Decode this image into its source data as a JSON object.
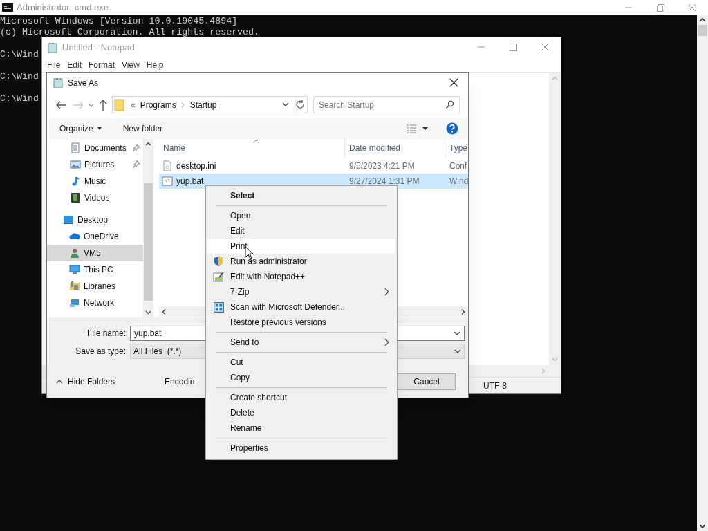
{
  "console": {
    "title": "Administrator: cmd.exe",
    "lines": [
      "Microsoft Windows [Version 10.0.19045.4894]",
      "(c) Microsoft Corporation. All rights reserved."
    ],
    "prompts": [
      "C:\\Wind",
      "C:\\Wind",
      "C:\\Wind"
    ]
  },
  "notepad": {
    "title": "Untitled - Notepad",
    "active": false,
    "menu": [
      "File",
      "Edit",
      "Format",
      "View",
      "Help"
    ],
    "encoding": "UTF-8"
  },
  "save_as": {
    "title": "Save As",
    "path_overflow": "«",
    "path": [
      "Programs",
      "Startup"
    ],
    "search": {
      "placeholder": "Search Startup"
    },
    "toolbar": {
      "organize": "Organize",
      "new_folder": "New folder"
    },
    "quick_access": [
      {
        "kind": "documents",
        "label": "Documents",
        "pinned": true,
        "selected": false
      },
      {
        "kind": "pictures",
        "label": "Pictures",
        "pinned": true,
        "selected": false
      },
      {
        "kind": "music",
        "label": "Music",
        "pinned": false,
        "selected": false
      },
      {
        "kind": "videos",
        "label": "Videos",
        "pinned": false,
        "selected": false
      }
    ],
    "tree": [
      {
        "kind": "desktop",
        "label": "Desktop",
        "selected": false,
        "children": [
          {
            "kind": "cloud",
            "label": "OneDrive",
            "selected": false
          },
          {
            "kind": "user",
            "label": "VM5",
            "selected": true
          },
          {
            "kind": "computer",
            "label": "This PC",
            "selected": false
          },
          {
            "kind": "libraries",
            "label": "Libraries",
            "selected": false
          },
          {
            "kind": "network",
            "label": "Network",
            "selected": false
          }
        ]
      }
    ],
    "columns": [
      "Name",
      "Date modified",
      "Type"
    ],
    "files": [
      {
        "kind": "settings",
        "name": "desktop.ini",
        "date": "9/5/2023 4:21 PM",
        "type": "Conf",
        "selected": false
      },
      {
        "kind": "batch",
        "name": "yup.bat",
        "date": "9/27/2024 1:31 PM",
        "type": "Wind",
        "selected": true
      }
    ],
    "file_name": {
      "label": "File name:",
      "value": "yup.bat"
    },
    "save_type": {
      "label": "Save as type:",
      "value": "All Files  (*.*)"
    },
    "hide_folders": "Hide Folders",
    "encoding_label": "Encodin",
    "cancel": "Cancel"
  },
  "context_menu": [
    {
      "kind": "default",
      "label": "Select",
      "highlighted": false
    },
    {
      "kind": "separator"
    },
    {
      "kind": "command",
      "label": "Open",
      "highlighted": false
    },
    {
      "kind": "command",
      "label": "Edit",
      "highlighted": false
    },
    {
      "kind": "command",
      "label": "Print",
      "highlighted": true
    },
    {
      "kind": "shield",
      "label": "Run as administrator",
      "highlighted": false
    },
    {
      "kind": "notepad",
      "label": "Edit with Notepad++",
      "highlighted": false
    },
    {
      "kind": "submenu",
      "label": "7-Zip",
      "highlighted": false
    },
    {
      "kind": "defender",
      "label": "Scan with Microsoft Defender...",
      "highlighted": false
    },
    {
      "kind": "command",
      "label": "Restore previous versions",
      "highlighted": false
    },
    {
      "kind": "separator"
    },
    {
      "kind": "submenu",
      "label": "Send to",
      "highlighted": false
    },
    {
      "kind": "separator"
    },
    {
      "kind": "command",
      "label": "Cut",
      "highlighted": false
    },
    {
      "kind": "command",
      "label": "Copy",
      "highlighted": false
    },
    {
      "kind": "separator"
    },
    {
      "kind": "command",
      "label": "Create shortcut",
      "highlighted": false
    },
    {
      "kind": "command",
      "label": "Delete",
      "highlighted": false
    },
    {
      "kind": "command",
      "label": "Rename",
      "highlighted": false
    },
    {
      "kind": "separator"
    },
    {
      "kind": "command",
      "label": "Properties",
      "highlighted": false
    }
  ]
}
